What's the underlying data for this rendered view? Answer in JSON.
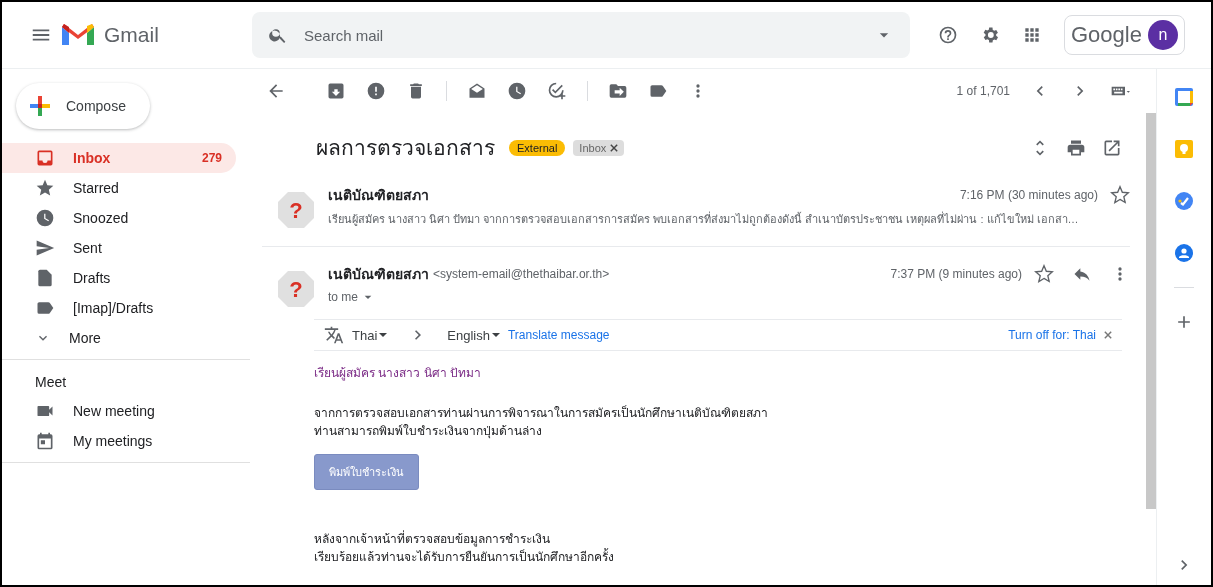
{
  "header": {
    "app_name": "Gmail",
    "search": {
      "placeholder": "Search mail"
    },
    "brand": "Google",
    "account_initial": "n"
  },
  "sidebar": {
    "compose": "Compose",
    "items": [
      {
        "kind": "inbox",
        "label": "Inbox",
        "count": "279",
        "selected": true
      },
      {
        "kind": "star",
        "label": "Starred",
        "selected": false
      },
      {
        "kind": "clock",
        "label": "Snoozed",
        "selected": false
      },
      {
        "kind": "send",
        "label": "Sent",
        "selected": false
      },
      {
        "kind": "file",
        "label": "Drafts",
        "selected": false
      },
      {
        "kind": "label",
        "label": "[Imap]/Drafts",
        "selected": false
      },
      {
        "kind": "chevron",
        "label": "More",
        "selected": false
      }
    ],
    "meet": {
      "heading": "Meet",
      "items": [
        {
          "kind": "video",
          "label": "New meeting"
        },
        {
          "kind": "calendar",
          "label": "My meetings"
        }
      ]
    }
  },
  "toolbar": {
    "counter": "1 of 1,701"
  },
  "thread": {
    "subject": "ผลการตรวจเอกสาร",
    "labels": [
      {
        "kind": "external",
        "text": "External"
      },
      {
        "kind": "folder",
        "text": "Inbox",
        "removable": true
      }
    ],
    "messages": [
      {
        "kind": "collapsed",
        "avatar": "?",
        "sender": "เนติบัณฑิตยสภา",
        "time": "7:16 PM (30 minutes ago)",
        "starred": false,
        "snippet": "เรียนผู้สมัคร นางสาว นิศา ปัทมา จากการตรวจสอบเอกสารการสมัคร พบเอกสารที่ส่งมาไม่ถูกต้องดังนี้ สำเนาบัตรประชาชน เหตุผลที่ไม่ผ่าน : แก้ไขใหม่ เอกสา…"
      },
      {
        "kind": "expanded",
        "avatar": "?",
        "sender": "เนติบัณฑิตยสภา",
        "email": "<system-email@thethaibar.or.th>",
        "time": "7:37 PM (9 minutes ago)",
        "starred": false,
        "recipient": "to me"
      }
    ]
  },
  "translate": {
    "from": "Thai",
    "to": "English",
    "action": "Translate message",
    "turn_off": "Turn off for: Thai"
  },
  "body": {
    "greeting": "เรียนผู้สมัคร นางสาว นิศา ปัทมา",
    "paragraph_1": [
      "จากการตรวจสอบเอกสารท่านผ่านการพิจารณาในการสมัครเป็นนักศึกษาเนติบัณฑิตยสภา",
      "ท่านสามารถพิมพ์ใบชำระเงินจากปุ่มด้านล่าง"
    ],
    "button": "พิมพ์ใบชำระเงิน",
    "paragraph_2": [
      "หลังจากเจ้าหน้าที่ตรวจสอบข้อมูลการชำระเงิน",
      "เรียบร้อยแล้วท่านจะได้รับการยืนยันการเป็นนักศึกษาอีกครั้ง"
    ]
  }
}
